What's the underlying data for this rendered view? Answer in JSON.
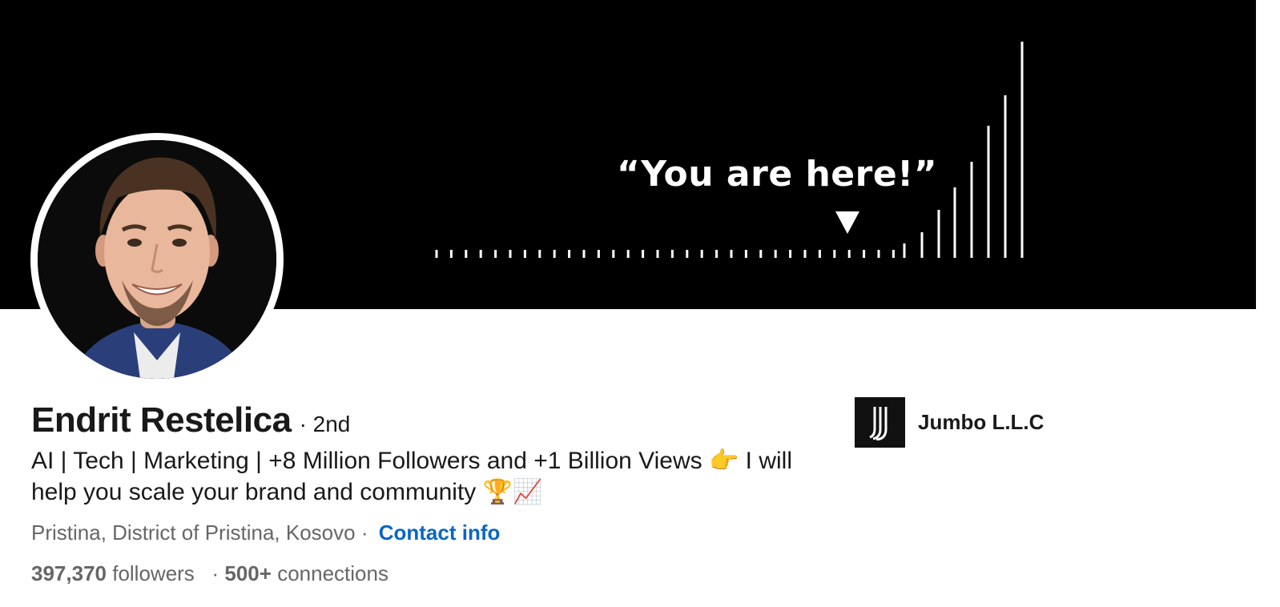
{
  "banner": {
    "quote": "“You are here!”"
  },
  "profile": {
    "name": "Endrit Restelica",
    "degree": "· 2nd",
    "headline": "AI | Tech | Marketing | +8 Million Followers and +1 Billion Views 👉 I will help you scale your brand and community 🏆📈",
    "location": "Pristina, District of Pristina, Kosovo",
    "separator": "·",
    "contact_label": "Contact info",
    "followers_count": "397,370",
    "followers_label": "followers",
    "stats_separator": "·",
    "connections_count": "500+",
    "connections_label": "connections"
  },
  "company": {
    "name": "Jumbo L.L.C"
  },
  "icons": {
    "logo": "jumbo-logo-icon",
    "marker": "triangle-down-icon"
  },
  "colors": {
    "banner_bg": "#000000",
    "link": "#0a66c2",
    "text": "#191919",
    "muted": "#666666"
  }
}
